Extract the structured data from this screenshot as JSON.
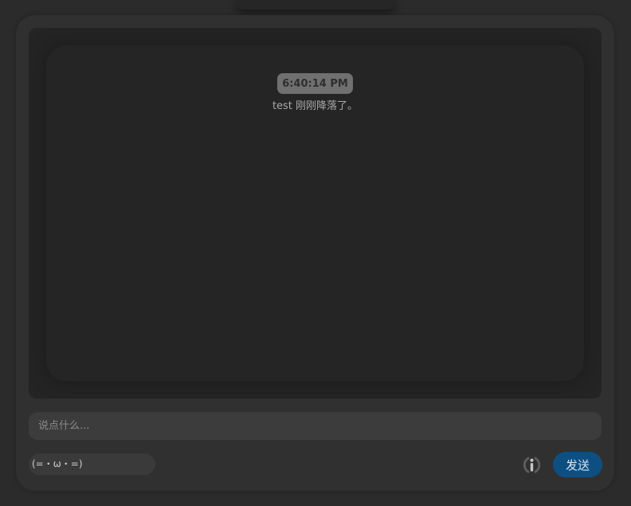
{
  "chat": {
    "messages": [
      {
        "timestamp": "6:40:14 PM",
        "text": "test 刚刚降落了。"
      }
    ]
  },
  "composer": {
    "placeholder": "说点什么...",
    "value": "",
    "emote": "(=・ω・=)",
    "info_icon": "info-icon",
    "send_label": "发送"
  },
  "colors": {
    "background": "#2b2b2b",
    "panel": "#303030",
    "messages_bg": "#242424",
    "accent": "#0e4f82"
  }
}
